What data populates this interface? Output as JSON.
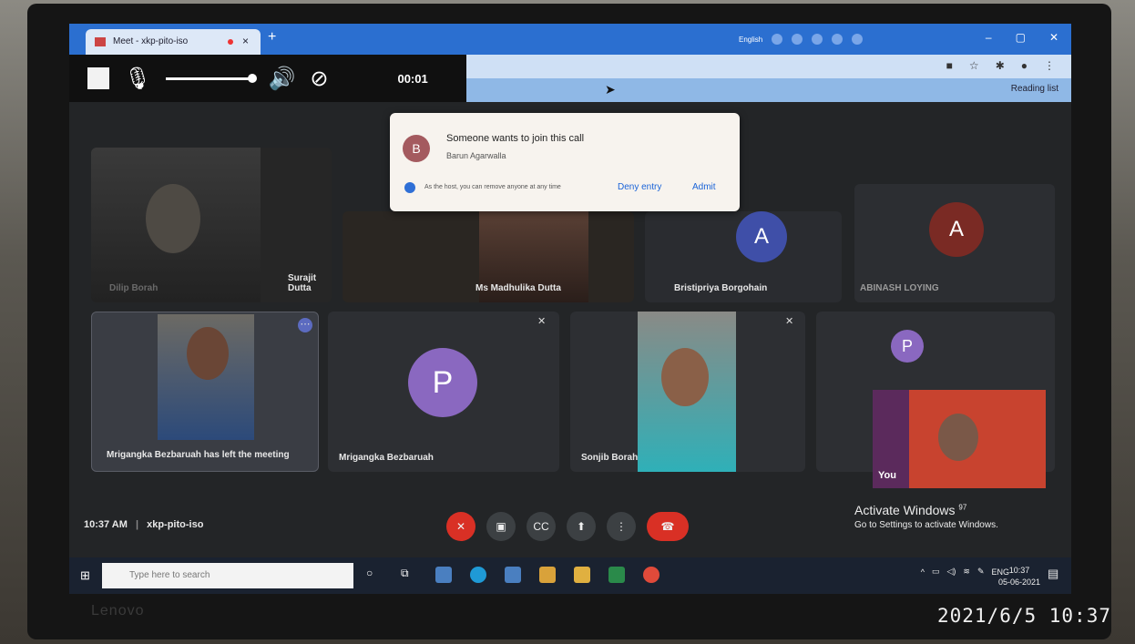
{
  "browser": {
    "tab_title": "Meet - xkp-pito-iso",
    "tab_close": "×",
    "new_tab": "+",
    "language": "English",
    "reading_list": "Reading list"
  },
  "media_bar": {
    "timer": "00:01"
  },
  "popup": {
    "avatar_letter": "B",
    "title": "Someone wants to join this call",
    "requester": "Barun Agarwalla",
    "note": "As the host, you can remove anyone at any time",
    "deny_label": "Deny entry",
    "admit_label": "Admit"
  },
  "tiles_row1": [
    {
      "name": "Surajit Dutta",
      "ghost_name": "Dilip Borah"
    },
    {
      "name": "Ms Madhulika Dutta"
    },
    {
      "name": "Bristipriya Borgohain",
      "avatar": "A"
    },
    {
      "name": "ABINASH LOYING",
      "avatar": "A"
    }
  ],
  "tiles_row2": [
    {
      "name": "Mrigangka Bezbaruah has left the meeting"
    },
    {
      "name": "Mrigangka Bezbaruah",
      "avatar": "P"
    },
    {
      "name": "Sonjib Borah"
    },
    {
      "name": "",
      "avatar": "P"
    }
  ],
  "self_view": {
    "label": "You"
  },
  "meeting": {
    "time": "10:37 AM",
    "separator": "|",
    "code": "xkp-pito-iso"
  },
  "activate_windows": {
    "title": "Activate Windows",
    "subtitle": "Go to Settings to activate Windows.",
    "badge": "97"
  },
  "taskbar": {
    "search_placeholder": "Type here to search",
    "lang": "ENG",
    "clock_time": "10:37",
    "clock_date": "05-06-2021"
  },
  "photo": {
    "brand": "Lenovo",
    "timestamp": "2021/6/5 10:37"
  }
}
